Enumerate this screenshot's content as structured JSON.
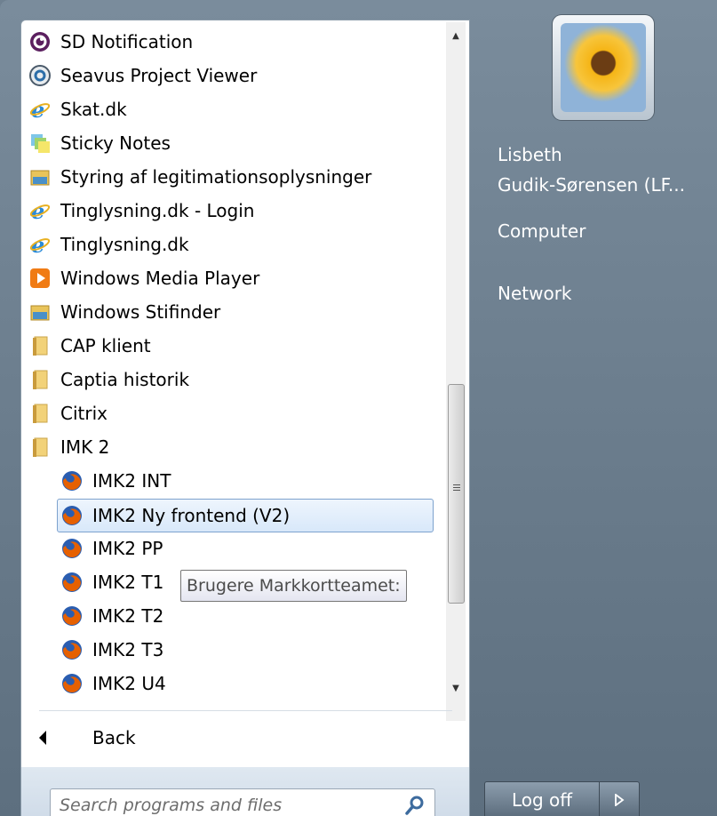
{
  "programs": [
    {
      "label": "SD Notification",
      "icon": "sd-notification-icon"
    },
    {
      "label": "Seavus Project Viewer",
      "icon": "seavus-icon"
    },
    {
      "label": "Skat.dk",
      "icon": "internet-explorer-icon"
    },
    {
      "label": "Sticky Notes",
      "icon": "sticky-notes-icon"
    },
    {
      "label": "Styring af legitimationsoplysninger",
      "icon": "credential-manager-icon"
    },
    {
      "label": "Tinglysning.dk - Login",
      "icon": "internet-explorer-icon"
    },
    {
      "label": "Tinglysning.dk",
      "icon": "internet-explorer-icon"
    },
    {
      "label": "Windows Media Player",
      "icon": "media-player-icon"
    },
    {
      "label": "Windows Stifinder",
      "icon": "explorer-icon"
    },
    {
      "label": "CAP klient",
      "icon": "folder-icon"
    },
    {
      "label": "Captia historik",
      "icon": "folder-icon"
    },
    {
      "label": "Citrix",
      "icon": "folder-icon"
    },
    {
      "label": "IMK 2",
      "icon": "folder-icon"
    },
    {
      "label": "IMK2 INT",
      "icon": "firefox-icon"
    },
    {
      "label": "IMK2 Ny frontend (V2)",
      "icon": "firefox-icon"
    },
    {
      "label": "IMK2 PP",
      "icon": "firefox-icon"
    },
    {
      "label": "IMK2 T1",
      "icon": "firefox-icon"
    },
    {
      "label": "IMK2 T2",
      "icon": "firefox-icon"
    },
    {
      "label": "IMK2 T3",
      "icon": "firefox-icon"
    },
    {
      "label": "IMK2 U4",
      "icon": "firefox-icon"
    }
  ],
  "tooltip": "Brugere Markkortteamet:",
  "back_label": "Back",
  "search": {
    "placeholder": "Search programs and files"
  },
  "user": {
    "name_line1": "Lisbeth",
    "name_line2": "Gudik-Sørensen (LF..."
  },
  "links": {
    "computer": "Computer",
    "network": "Network"
  },
  "logoff_label": "Log off"
}
